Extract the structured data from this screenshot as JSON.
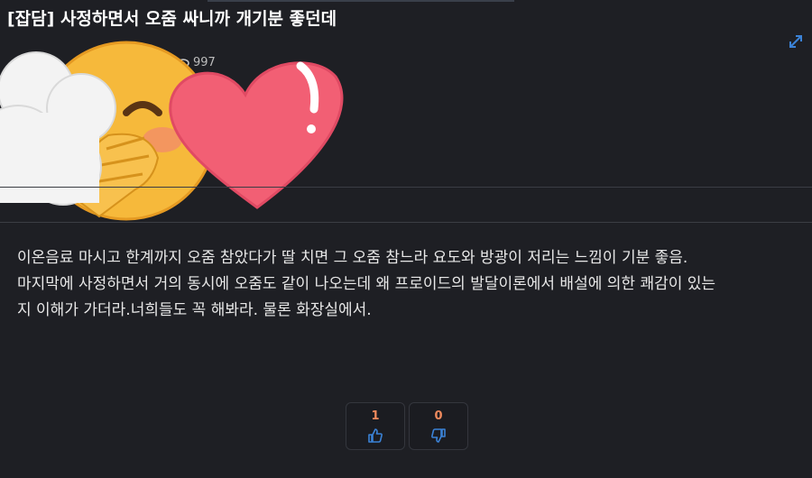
{
  "post": {
    "title": "[잡담] 사정하면서 오줌 싸니까 개기분 좋던데",
    "views": "997",
    "body_lines": [
      "이온음료 마시고 한계까지 오줌 참았다가 딸 치면 그 오줌 참느라 요도와 방광이 저리는 느낌이 기분 좋음.",
      "마지막에 사정하면서 거의 동시에 오줌도 같이 나오는데 왜 프로이드의 발달이론에서 배설에 의한 쾌감이 있는",
      "지 이해가 가더라.너희들도 꼭 해봐라. 물론 화장실에서."
    ]
  },
  "votes": {
    "up_count": "1",
    "down_count": "0"
  },
  "icons": {
    "expand": "expand-icon",
    "sticker": "blushing-face-heart-sticker",
    "up": "thumbs-up-icon",
    "down": "thumbs-down-icon"
  },
  "colors": {
    "background": "#1e1f24",
    "accent": "#3b82d6",
    "count": "#f08a5d"
  }
}
